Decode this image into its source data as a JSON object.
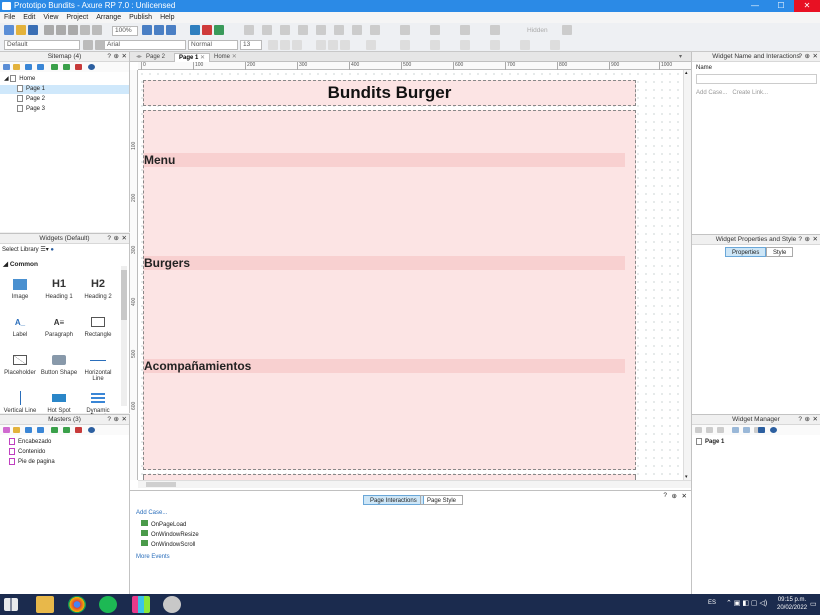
{
  "window": {
    "title": "Prototipo Bundits - Axure RP 7.0 : Unlicensed",
    "min": "—",
    "max": "☐",
    "close": "✕"
  },
  "menu": [
    "File",
    "Edit",
    "View",
    "Project",
    "Arrange",
    "Publish",
    "Help"
  ],
  "toolbar": {
    "zoom": "100%",
    "style": "Default",
    "font": "Arial",
    "weight": "Normal",
    "size": "13",
    "hidden": "Hidden"
  },
  "sitemap": {
    "title": "Sitemap (4)",
    "items": [
      {
        "label": "Home"
      },
      {
        "label": "Page 1"
      },
      {
        "label": "Page 2"
      },
      {
        "label": "Page 3"
      }
    ]
  },
  "widgets": {
    "title": "Widgets (Default)",
    "select_library": "Select Library",
    "category": "Common",
    "items": [
      {
        "label": "Image",
        "glyph": ""
      },
      {
        "label": "Heading 1",
        "glyph": "H1"
      },
      {
        "label": "Heading 2",
        "glyph": "H2"
      },
      {
        "label": "Label",
        "glyph": "A_"
      },
      {
        "label": "Paragraph",
        "glyph": "A≡"
      },
      {
        "label": "Rectangle",
        "glyph": ""
      },
      {
        "label": "Placeholder",
        "glyph": ""
      },
      {
        "label": "Button Shape",
        "glyph": ""
      },
      {
        "label": "Horizontal Line",
        "glyph": ""
      },
      {
        "label": "Vertical Line",
        "glyph": ""
      },
      {
        "label": "Hot Spot",
        "glyph": ""
      },
      {
        "label": "Dynamic Panel",
        "glyph": ""
      }
    ]
  },
  "masters": {
    "title": "Masters (3)",
    "items": [
      {
        "label": "Encabezado"
      },
      {
        "label": "Contenido"
      },
      {
        "label": "Pie de pagina"
      }
    ]
  },
  "tabs": [
    {
      "label": "Page 2"
    },
    {
      "label": "Page 1"
    },
    {
      "label": "Home"
    }
  ],
  "ruler": {
    "h": [
      "0",
      "100",
      "200",
      "300",
      "400",
      "500",
      "600",
      "700",
      "800",
      "900",
      "1000"
    ],
    "v": [
      "100",
      "200",
      "300",
      "400",
      "500",
      "600"
    ]
  },
  "canvas": {
    "header_title": "Bundits Burger",
    "sections": [
      {
        "label": "Menu"
      },
      {
        "label": "Burgers"
      },
      {
        "label": "Acompañamientos"
      }
    ]
  },
  "page_panel": {
    "tabs": [
      {
        "label": "Page Interactions"
      },
      {
        "label": "Page Style"
      }
    ],
    "add_case": "Add Case...",
    "events": [
      {
        "label": "OnPageLoad"
      },
      {
        "label": "OnWindowResize"
      },
      {
        "label": "OnWindowScroll"
      }
    ],
    "more_events": "More Events"
  },
  "widget_interactions": {
    "title": "Widget Name and Interactions",
    "name_label": "Name",
    "add_case": "Add Case...",
    "create_link": "Create Link..."
  },
  "widget_props": {
    "title": "Widget Properties and Style",
    "tabs": [
      {
        "label": "Properties"
      },
      {
        "label": "Style"
      }
    ]
  },
  "widget_manager": {
    "title": "Widget Manager",
    "page": "Page 1"
  },
  "taskbar": {
    "lang": "ES",
    "time": "09:15 p.m.",
    "date": "20/02/2022"
  },
  "colors": {
    "accent": "#2b8ae6",
    "artboard": "#fce4e4",
    "strip": "#f8d0d0",
    "taskbar": "#1b2b4e"
  }
}
